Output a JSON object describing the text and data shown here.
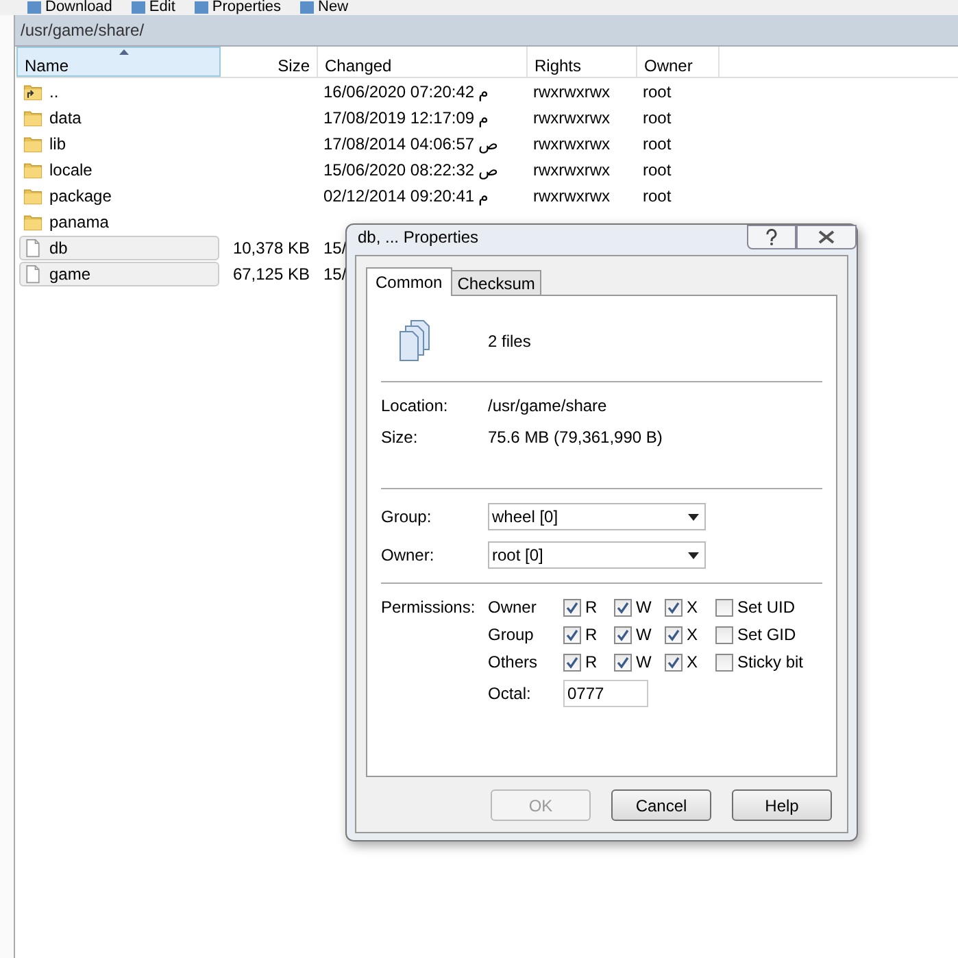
{
  "toolbar": {
    "items": [
      {
        "label": "Download"
      },
      {
        "label": "Edit"
      },
      {
        "label": "Properties"
      },
      {
        "label": "New"
      }
    ]
  },
  "path_bar": {
    "path": "/usr/game/share/"
  },
  "table": {
    "columns": [
      {
        "label": "Name",
        "sorted": true
      },
      {
        "label": "Size",
        "sorted": false
      },
      {
        "label": "Changed",
        "sorted": false
      },
      {
        "label": "Rights",
        "sorted": false
      },
      {
        "label": "Owner",
        "sorted": false
      }
    ],
    "rows": [
      {
        "kind": "parent",
        "name": "..",
        "size": "",
        "changed": "16/06/2020 07:20:42",
        "ampm": "م",
        "rights": "rwxrwxrwx",
        "owner": "root",
        "selected": false
      },
      {
        "kind": "folder",
        "name": "data",
        "size": "",
        "changed": "17/08/2019 12:17:09",
        "ampm": "م",
        "rights": "rwxrwxrwx",
        "owner": "root",
        "selected": false
      },
      {
        "kind": "folder",
        "name": "lib",
        "size": "",
        "changed": "17/08/2014 04:06:57",
        "ampm": "ص",
        "rights": "rwxrwxrwx",
        "owner": "root",
        "selected": false
      },
      {
        "kind": "folder",
        "name": "locale",
        "size": "",
        "changed": "15/06/2020 08:22:32",
        "ampm": "ص",
        "rights": "rwxrwxrwx",
        "owner": "root",
        "selected": false
      },
      {
        "kind": "folder",
        "name": "package",
        "size": "",
        "changed": "02/12/2014 09:20:41",
        "ampm": "م",
        "rights": "rwxrwxrwx",
        "owner": "root",
        "selected": false
      },
      {
        "kind": "folder",
        "name": "panama",
        "size": "",
        "changed": "",
        "ampm": "",
        "rights": "",
        "owner": "",
        "selected": false
      },
      {
        "kind": "file",
        "name": "db",
        "size": "10,378 KB",
        "changed": "15/",
        "ampm": "",
        "rights": "",
        "owner": "",
        "selected": true
      },
      {
        "kind": "file",
        "name": "game",
        "size": "67,125 KB",
        "changed": "15/",
        "ampm": "",
        "rights": "",
        "owner": "",
        "selected": true
      }
    ]
  },
  "dialog": {
    "title": "db, ... Properties",
    "tabs": [
      {
        "label": "Common",
        "selected": true
      },
      {
        "label": "Checksum",
        "selected": false
      }
    ],
    "summary": "2 files",
    "location_label": "Location:",
    "location": "/usr/game/share",
    "size_label": "Size:",
    "size": "75.6 MB (79,361,990 B)",
    "group_label": "Group:",
    "group": "wheel [0]",
    "owner_label": "Owner:",
    "owner": "root [0]",
    "permissions_label": "Permissions:",
    "permissions": [
      {
        "name": "Owner",
        "flags": [
          {
            "label": "R",
            "checked": true
          },
          {
            "label": "W",
            "checked": true
          },
          {
            "label": "X",
            "checked": true
          }
        ],
        "special": {
          "label": "Set UID",
          "checked": false
        }
      },
      {
        "name": "Group",
        "flags": [
          {
            "label": "R",
            "checked": true
          },
          {
            "label": "W",
            "checked": true
          },
          {
            "label": "X",
            "checked": true
          }
        ],
        "special": {
          "label": "Set GID",
          "checked": false
        }
      },
      {
        "name": "Others",
        "flags": [
          {
            "label": "R",
            "checked": true
          },
          {
            "label": "W",
            "checked": true
          },
          {
            "label": "X",
            "checked": true
          }
        ],
        "special": {
          "label": "Sticky bit",
          "checked": false
        }
      }
    ],
    "octal_label": "Octal:",
    "octal": "0777",
    "buttons": [
      {
        "label": "OK",
        "disabled": true
      },
      {
        "label": "Cancel",
        "disabled": false
      },
      {
        "label": "Help",
        "disabled": false
      }
    ]
  }
}
